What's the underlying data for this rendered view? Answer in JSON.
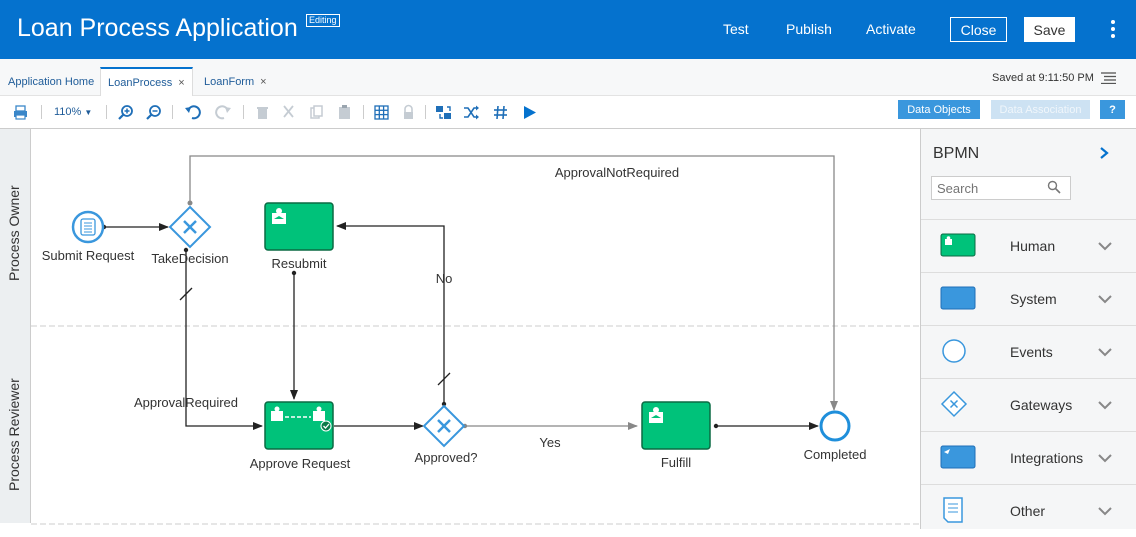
{
  "header": {
    "title": "Loan Process Application",
    "badge": "Editing",
    "links": {
      "test": "Test",
      "publish": "Publish",
      "activate": "Activate"
    },
    "close_label": "Close",
    "save_label": "Save"
  },
  "tabs": [
    {
      "label": "Application Home",
      "closable": false
    },
    {
      "label": "LoanProcess",
      "closable": true,
      "active": true
    },
    {
      "label": "LoanForm",
      "closable": true
    }
  ],
  "tab_close_glyph": "×",
  "saved_at": "Saved at 9:11:50 PM",
  "toolbar": {
    "zoom": "110%",
    "data_objects_label": "Data Objects",
    "data_association_label": "Data Association",
    "help_label": "?"
  },
  "lanes": [
    {
      "name": "Process Owner"
    },
    {
      "name": "Process Reviewer"
    }
  ],
  "diagram": {
    "nodes": {
      "submit_request": "Submit Request",
      "take_decision": "TakeDecision",
      "resubmit": "Resubmit",
      "approve_request": "Approve Request",
      "approved": "Approved?",
      "fulfill": "Fulfill",
      "completed": "Completed"
    },
    "flow_labels": {
      "approval_not_required": "ApprovalNotRequired",
      "approval_required": "ApprovalRequired",
      "no": "No",
      "yes": "Yes"
    }
  },
  "palette": {
    "title": "BPMN",
    "search_placeholder": "Search",
    "items": [
      {
        "label": "Human",
        "icon": "human-task-icon"
      },
      {
        "label": "System",
        "icon": "system-task-icon"
      },
      {
        "label": "Events",
        "icon": "event-icon"
      },
      {
        "label": "Gateways",
        "icon": "gateway-icon"
      },
      {
        "label": "Integrations",
        "icon": "integration-icon"
      },
      {
        "label": "Other",
        "icon": "document-icon"
      }
    ]
  },
  "colors": {
    "header_blue": "#0572ce",
    "task_green": "#00c27a",
    "gateway_blue": "#3a97dd"
  }
}
